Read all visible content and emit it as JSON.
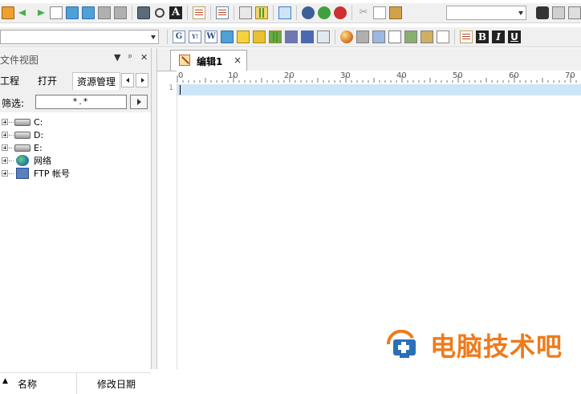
{
  "toolbar2": {
    "letter_icons": [
      "G",
      "Y!",
      "W"
    ]
  },
  "format_icons": {
    "bold": "B",
    "italic": "I",
    "underline": "U"
  },
  "panel": {
    "title": "文件视图",
    "pin_glyph": "▼",
    "pin2_glyph": "ᵖ",
    "close_glyph": "✕",
    "tabs": [
      "工程",
      "打开",
      "资源管理"
    ],
    "filter_label": "筛选:",
    "filter_value": "*.*",
    "tree": [
      {
        "label": "C:",
        "icon": "drive-icon"
      },
      {
        "label": "D:",
        "icon": "drive-icon"
      },
      {
        "label": "E:",
        "icon": "drive-icon"
      },
      {
        "label": "网络",
        "icon": "network-icon"
      },
      {
        "label": "FTP 帐号",
        "icon": "ftp-icon"
      }
    ],
    "columns": {
      "sort_glyph": "▲",
      "name": "名称",
      "date": "修改日期"
    }
  },
  "editor": {
    "tab_label": "编辑1",
    "tab_close": "×",
    "ruler_numbers": [
      "0",
      "10",
      "20",
      "30",
      "40",
      "50",
      "60",
      "70"
    ],
    "line_number": "1"
  },
  "watermark": {
    "text": "电脑技术吧",
    "color": "#ef7a1a"
  }
}
